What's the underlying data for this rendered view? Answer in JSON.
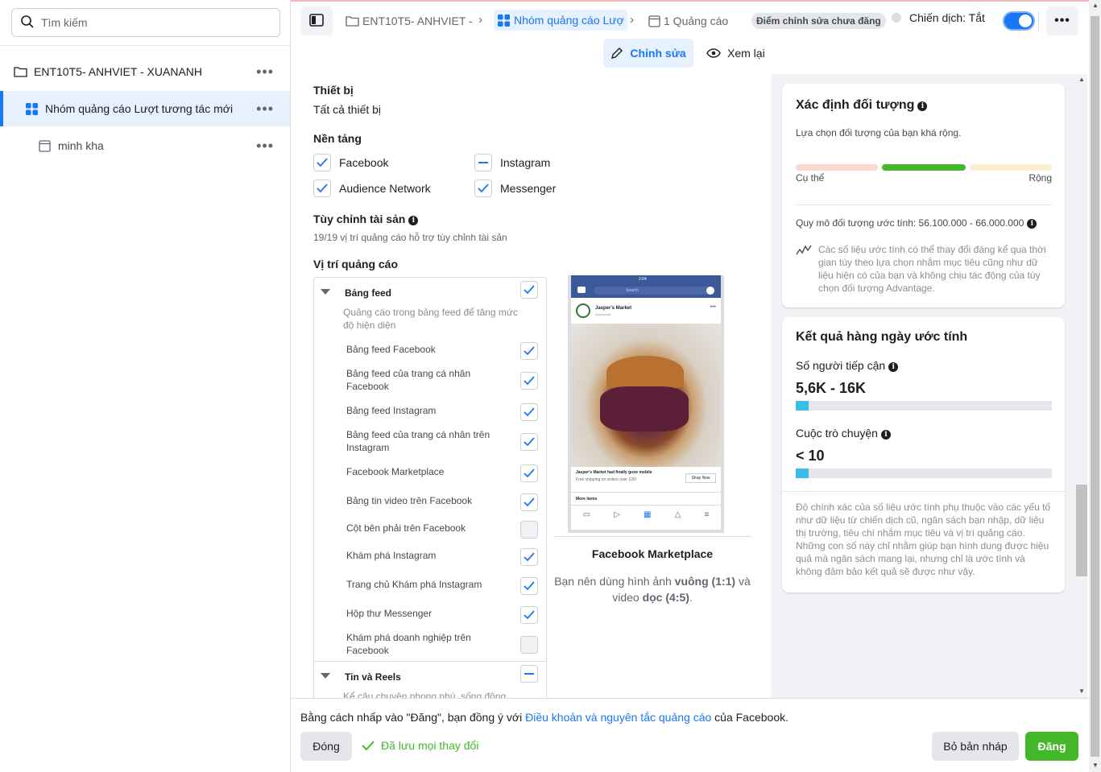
{
  "colors": {
    "accent": "#1877f2",
    "publish": "#42b72a",
    "meter_narrow": "#fbd9d3",
    "meter_ok": "#42b72a",
    "meter_broad": "#fdf0d0",
    "estimate_bar": "#3cbde6"
  },
  "sidebar": {
    "search_placeholder": "Tìm kiếm",
    "items": [
      {
        "label": "ENT10T5- ANHVIET - XUANANH",
        "icon": "folder-icon",
        "more": "•••"
      },
      {
        "label": "Nhóm quảng cáo Lượt tương tác mới",
        "icon": "adset-grid-icon",
        "more": "•••"
      },
      {
        "label": "minh kha",
        "icon": "ad-icon",
        "more": "•••"
      }
    ]
  },
  "header": {
    "breadcrumbs": [
      {
        "label": "ENT10T5- ANHVIET -",
        "icon": "folder-icon"
      },
      {
        "label": "Nhóm quảng cáo Lượ",
        "icon": "adset-grid-icon"
      },
      {
        "label": "1 Quảng cáo",
        "icon": "ad-icon"
      }
    ],
    "draft_badge": "Điểm chỉnh sửa chưa đăng",
    "campaign_status": "Chiến dịch: Tắt",
    "more": "•••",
    "edit_label": "Chỉnh sửa",
    "review_label": "Xem lại"
  },
  "main": {
    "devices_label": "Thiết bị",
    "devices_value": "Tất cả thiết bị",
    "platforms_label": "Nền tảng",
    "platforms": [
      {
        "label": "Facebook",
        "state": "checked"
      },
      {
        "label": "Instagram",
        "state": "partial"
      },
      {
        "label": "Audience Network",
        "state": "checked"
      },
      {
        "label": "Messenger",
        "state": "checked"
      }
    ],
    "asset_label": "Tùy chỉnh tài sản",
    "asset_sub": "19/19 vị trí quảng cáo hỗ trợ tùy chỉnh tài sản",
    "placements_label": "Vị trí quảng cáo",
    "feeds_group": "Bảng feed",
    "feeds_desc": "Quảng cáo trong bảng feed để tăng mức độ hiện diện",
    "placements": [
      {
        "label": "Bảng feed Facebook",
        "checked": "true"
      },
      {
        "label": "Bảng feed của trang cá nhân Facebook",
        "checked": "true"
      },
      {
        "label": "Bảng feed Instagram",
        "checked": "true"
      },
      {
        "label": "Bảng feed của trang cá nhân trên Instagram",
        "checked": "true"
      },
      {
        "label": "Facebook Marketplace",
        "checked": "true"
      },
      {
        "label": "Bảng tin video trên Facebook",
        "checked": "true"
      },
      {
        "label": "Cột bên phải trên Facebook",
        "checked": "false"
      },
      {
        "label": "Khám phá Instagram",
        "checked": "true"
      },
      {
        "label": "Trang chủ Khám phá Instagram",
        "checked": "true"
      },
      {
        "label": "Hộp thư Messenger",
        "checked": "true"
      },
      {
        "label": "Khám phá doanh nghiệp trên Facebook",
        "checked": "false"
      }
    ],
    "stories_group": "Tin và Reels",
    "stories_desc": "Kể câu chuyện phong phú, sống động",
    "preview": {
      "status_time": "2:04",
      "search": "Search",
      "page_name": "Jasper's Market",
      "sponsored": "Sponsored",
      "caption": "Jasper's Market had finally gone mobile",
      "caption_sub": "Free shipping on orders over 100!",
      "cta": "Shop Now",
      "more_items": "More items",
      "title": "Facebook Marketplace",
      "desc_pre": "Bạn nên dùng hình ảnh ",
      "desc_b1": "vuông (1:1)",
      "desc_mid": " và video ",
      "desc_b2": "dọc (4:5)",
      "desc_end": "."
    }
  },
  "audience": {
    "title": "Xác định đối tượng",
    "desc": "Lựa chọn đối tượng của bạn khá rộng.",
    "narrow": "Cụ thể",
    "broad": "Rộng",
    "size": "Quy mô đối tượng ước tính: 56.100.000 - 66.000.000",
    "note": "Các số liệu ước tính có thể thay đổi đáng kể qua thời gian tùy theo lựa chọn nhắm mục tiêu cũng như dữ liệu hiện có của bạn và không chịu tác động của tùy chọn đối tượng Advantage."
  },
  "estimates": {
    "title": "Kết quả hàng ngày ước tính",
    "reach_label": "Số người tiếp cận",
    "reach_value": "5,6K - 16K",
    "reach_fill": 0.05,
    "conv_label": "Cuộc trò chuyện",
    "conv_value": "< 10",
    "conv_fill": 0.05,
    "note": "Độ chính xác của số liệu ước tính phụ thuộc vào các yếu tố như dữ liệu từ chiến dịch cũ, ngân sách bạn nhập, dữ liệu thị trường, tiêu chí nhắm mục tiêu và vị trí quảng cáo. Những con số này chỉ nhằm giúp bạn hình dung được hiệu quả mà ngân sách mang lại, nhưng chỉ là ước tính và không đảm bảo kết quả sẽ được như vậy."
  },
  "footer": {
    "terms_pre": "Bằng cách nhấp vào \"Đăng\", bạn đồng ý với ",
    "terms_link": "Điều khoản và nguyên tắc quảng cáo",
    "terms_post": " của Facebook.",
    "close": "Đóng",
    "saved": "Đã lưu mọi thay đổi",
    "discard": "Bỏ bản nháp",
    "publish": "Đăng"
  }
}
